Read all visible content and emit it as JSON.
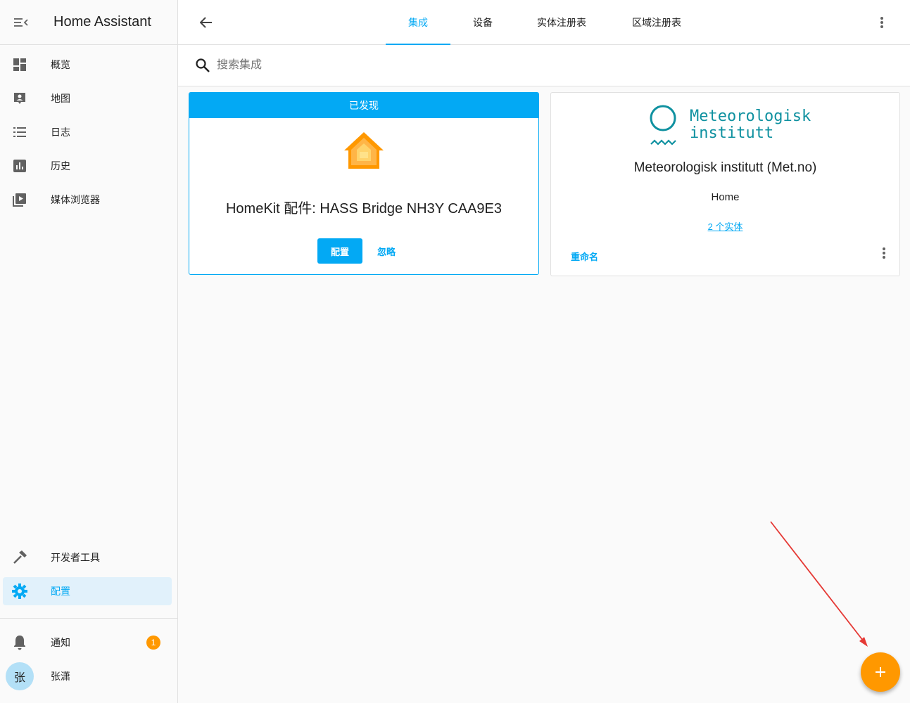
{
  "app": {
    "title": "Home Assistant"
  },
  "sidebar": {
    "items": [
      {
        "label": "概览",
        "icon": "dashboard-icon"
      },
      {
        "label": "地图",
        "icon": "map-icon"
      },
      {
        "label": "日志",
        "icon": "logbook-icon"
      },
      {
        "label": "历史",
        "icon": "history-chart-icon"
      },
      {
        "label": "媒体浏览器",
        "icon": "media-browser-icon"
      }
    ],
    "bottom_items": [
      {
        "label": "开发者工具",
        "icon": "hammer-icon"
      },
      {
        "label": "配置",
        "icon": "gear-icon",
        "active": true
      }
    ],
    "notifications": {
      "label": "通知",
      "badge": "1"
    },
    "user": {
      "name": "张潇",
      "initial": "张"
    }
  },
  "topbar": {
    "tabs": [
      {
        "label": "集成",
        "active": true
      },
      {
        "label": "设备"
      },
      {
        "label": "实体注册表"
      },
      {
        "label": "区域注册表"
      }
    ]
  },
  "search": {
    "placeholder": "搜索集成"
  },
  "cards": {
    "discovered": {
      "banner": "已发现",
      "title": "HomeKit 配件: HASS Bridge NH3Y CAA9E3",
      "configure_label": "配置",
      "ignore_label": "忽略"
    },
    "met": {
      "logo_text": "Meteorologisk\ninstitutt",
      "title": "Meteorologisk institutt (Met.no)",
      "subtitle": "Home",
      "entities_link": "2 个实体",
      "rename_label": "重命名"
    }
  },
  "colors": {
    "accent": "#03a9f4",
    "fab": "#ff9800",
    "badge": "#ff9800",
    "annotation_arrow": "#e53935"
  }
}
